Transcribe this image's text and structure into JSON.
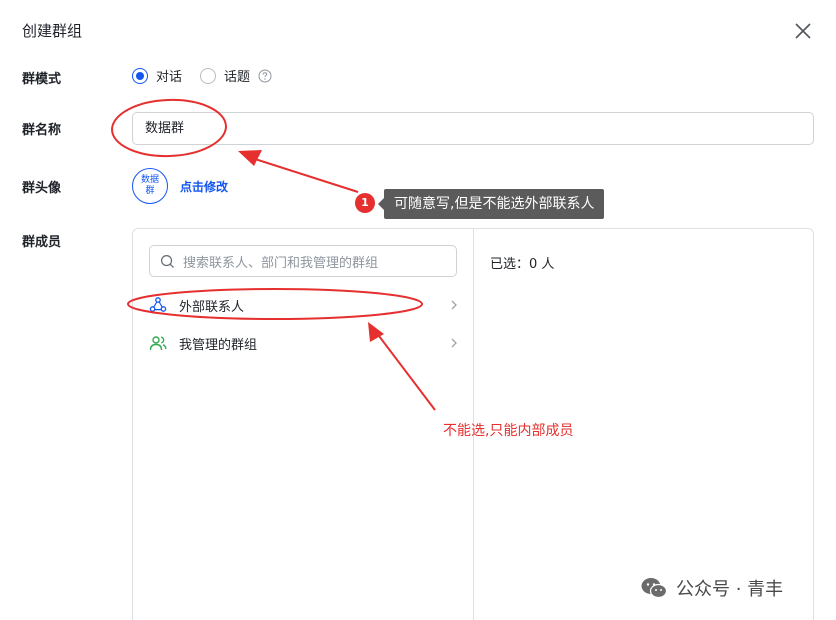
{
  "dialog": {
    "title": "创建群组"
  },
  "form": {
    "mode_label": "群模式",
    "mode_options": [
      {
        "label": "对话",
        "selected": true
      },
      {
        "label": "话题",
        "selected": false
      }
    ],
    "name_label": "群名称",
    "name_value": "数据群",
    "avatar_label": "群头像",
    "avatar_text": "数据群",
    "avatar_edit": "点击修改",
    "members_label": "群成员"
  },
  "members": {
    "search_placeholder": "搜索联系人、部门和我管理的群组",
    "items": [
      {
        "label": "外部联系人",
        "icon": "external-contacts-icon"
      },
      {
        "label": "我管理的群组",
        "icon": "managed-groups-icon"
      }
    ],
    "selected_text": "已选：0 人"
  },
  "annotations": {
    "badge_number": "1",
    "tooltip_text": "可随意写,但是不能选外部联系人",
    "note_text": "不能选,只能内部成员"
  },
  "watermark": {
    "text": "公众号 · 青丰"
  },
  "colors": {
    "accent": "#1456f0",
    "annotation_red": "#e5302f",
    "tooltip_bg": "#5b5b5b",
    "green_icon": "#34a853"
  }
}
